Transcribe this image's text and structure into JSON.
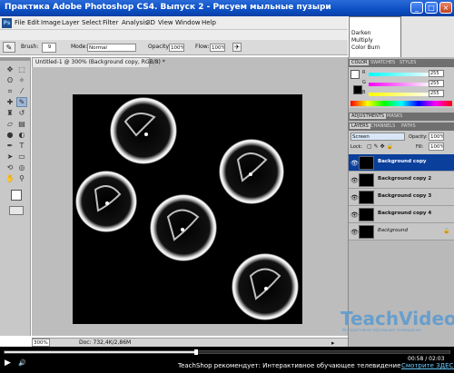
{
  "window": {
    "title": "Практика Adobe Photoshop CS4. Выпуск 2 - Рисуем мыльные пузыри",
    "minimize": "_",
    "maximize": "□",
    "close": "×"
  },
  "menu": {
    "app_icon": "Ps",
    "items": [
      "File",
      "Edit",
      "Image",
      "Layer",
      "Select",
      "Filter",
      "Analysis",
      "3D",
      "View",
      "Window",
      "Help"
    ]
  },
  "options": {
    "brush_label": "Brush:",
    "brush_size": "9",
    "mode_label": "Mode:",
    "mode_value": "Normal",
    "opacity_label": "Opacity:",
    "opacity_value": "100%",
    "flow_label": "Flow:",
    "flow_value": "100%"
  },
  "blend_popup": {
    "items": [
      "Darken",
      "Multiply",
      "Color Burn"
    ]
  },
  "document": {
    "tab_title": "Untitled-1 @ 300% (Background copy, RGB/8) *",
    "zoom": "300%",
    "doc_info": "Doc: 732,4K/2,86M"
  },
  "color_panel": {
    "tabs": [
      "COLOR",
      "SWATCHES",
      "STYLES"
    ],
    "channels": [
      {
        "label": "R",
        "value": "255"
      },
      {
        "label": "G",
        "value": "255"
      },
      {
        "label": "B",
        "value": "255"
      }
    ]
  },
  "adjustments_panel": {
    "tabs": [
      "ADJUSTMENTS",
      "MASKS"
    ]
  },
  "layers_panel": {
    "tabs": [
      "LAYERS",
      "CHANNELS",
      "PATHS"
    ],
    "blend_mode": "Screen",
    "opacity_label": "Opacity:",
    "opacity_value": "100%",
    "lock_label": "Lock:",
    "fill_label": "Fill:",
    "fill_value": "100%",
    "layers": [
      {
        "name": "Background copy",
        "selected": true
      },
      {
        "name": "Background copy 2",
        "selected": false
      },
      {
        "name": "Background copy 3",
        "selected": false
      },
      {
        "name": "Background copy 4",
        "selected": false
      },
      {
        "name": "Background",
        "selected": false
      }
    ]
  },
  "watermark": {
    "brand": "TeachVideo",
    "tagline": "Интерактивное обучающее телевидение"
  },
  "player": {
    "progress": 0.43,
    "time": "00:58 / 02:03",
    "promo_text": "TeachShop рекомендует: Интерактивное обучающее телевидение",
    "promo_link": "Смотрите ЗДЕСЬ"
  },
  "colors": {
    "titlebar": "#0c4fc4",
    "selected_layer": "#0a3f9c",
    "canvas": "#000000",
    "watermark": "#5a9ad0"
  }
}
